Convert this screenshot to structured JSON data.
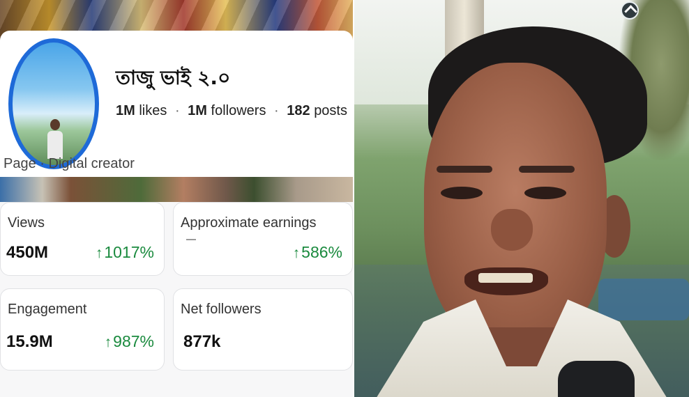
{
  "profile": {
    "name": "তাজু ভাই ২.০",
    "likes_count": "1M",
    "likes_label": "likes",
    "followers_count": "1M",
    "followers_label": "followers",
    "posts_count": "182",
    "posts_label": "posts",
    "separator": "·",
    "page_type": "Page · Digital creator"
  },
  "insights": [
    {
      "label": "Views",
      "value": "450M",
      "change": "1017%",
      "arrow": "↑"
    },
    {
      "label": "Approximate earnings",
      "value": "—",
      "change": "586%",
      "arrow": "↑"
    },
    {
      "label": "Engagement",
      "value": "15.9M",
      "change": "987%",
      "arrow": "↑"
    },
    {
      "label": "Net followers",
      "value": "877k"
    }
  ],
  "colors": {
    "accent_blue": "#1e6ad8",
    "positive_green": "#1a8a3e",
    "card_border": "#e0e1e4"
  },
  "icons": {
    "channel_logo": "news-channel-logo-icon",
    "up_arrow": "arrow-up-icon"
  }
}
